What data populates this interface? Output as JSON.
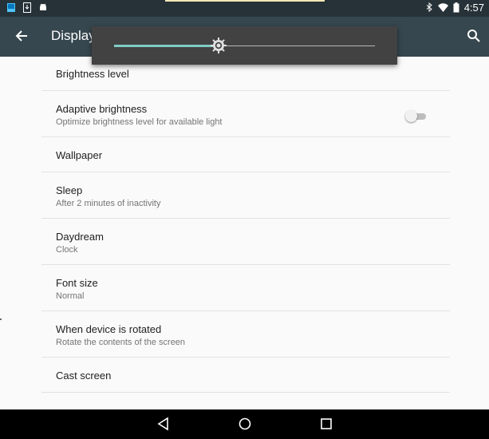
{
  "status": {
    "time": "4:57"
  },
  "appbar": {
    "title": "Display"
  },
  "brightness": {
    "level": 0.4
  },
  "settings": [
    {
      "title": "Brightness level"
    },
    {
      "title": "Adaptive brightness",
      "summary": "Optimize brightness level for available light"
    },
    {
      "title": "Wallpaper"
    },
    {
      "title": "Sleep",
      "summary": "After 2 minutes of inactivity"
    },
    {
      "title": "Daydream",
      "summary": "Clock"
    },
    {
      "title": "Font size",
      "summary": "Normal"
    },
    {
      "title": "When device is rotated",
      "summary": "Rotate the contents of the screen"
    },
    {
      "title": "Cast screen"
    }
  ],
  "colors": {
    "appbar": "#37474f",
    "status_bar": "#263238",
    "accent": "#80cbc4"
  }
}
